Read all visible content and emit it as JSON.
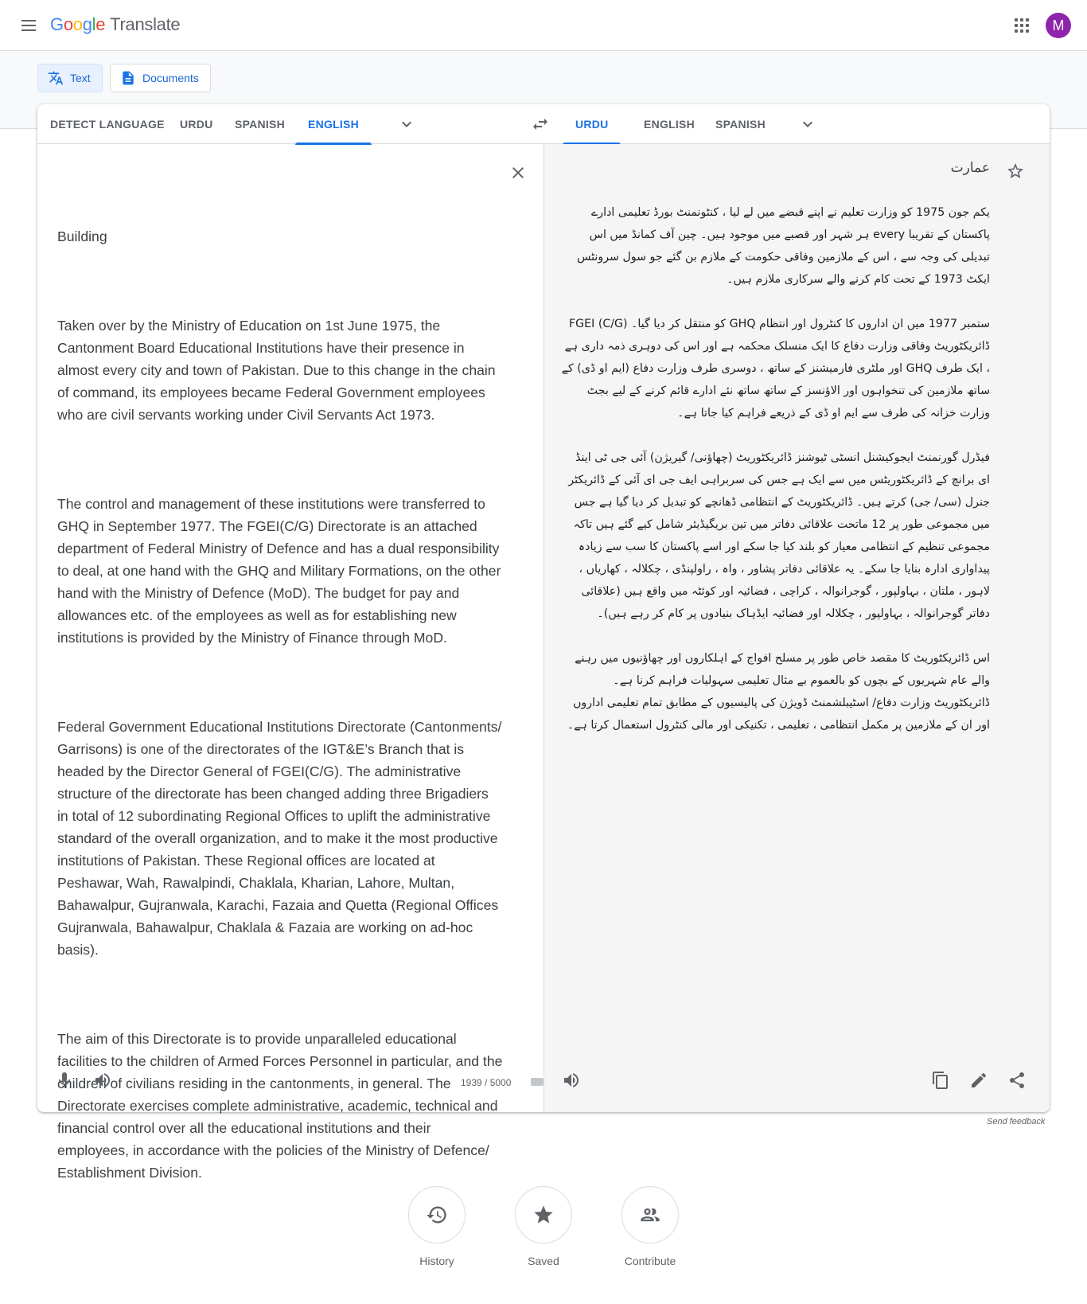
{
  "header": {
    "logo_letters": [
      "G",
      "o",
      "o",
      "g",
      "l",
      "e"
    ],
    "logo_colors": [
      "#4285f4",
      "#ea4335",
      "#fbbc05",
      "#4285f4",
      "#34a853",
      "#ea4335"
    ],
    "product": "Translate",
    "avatar_letter": "M",
    "avatar_color": "#8e24aa"
  },
  "modes": {
    "text": "Text",
    "documents": "Documents"
  },
  "source_langs": [
    "DETECT LANGUAGE",
    "URDU",
    "SPANISH",
    "ENGLISH"
  ],
  "source_active": "ENGLISH",
  "target_langs": [
    "URDU",
    "ENGLISH",
    "SPANISH"
  ],
  "target_active": "URDU",
  "source": {
    "paragraphs": [
      "Building",
      "Taken over by the Ministry of Education on 1st June 1975, the Cantonment Board Educational Institutions have their presence in almost every city and town of Pakistan. Due to this change in the chain of command, its employees became Federal Government employees who are civil servants working under Civil Servants Act 1973.",
      "The control and management of these institutions were transferred to GHQ in September 1977. The FGEI(C/G) Directorate is an attached department of Federal Ministry of Defence and has a dual responsibility to deal, at one hand with the GHQ and Military Formations, on the other hand with the Ministry of Defence (MoD). The budget for pay and allowances etc. of the employees as well as for establishing new institutions is provided by the Ministry of Finance through MoD.",
      "Federal Government Educational Institutions Directorate (Cantonments/ Garrisons) is one of the directorates of the IGT&E’s Branch that is headed by the Director General of FGEI(C/G). The administrative structure of the directorate has been changed adding three Brigadiers in total of 12 subordinating Regional Offices to uplift the administrative standard of the overall organization, and to make it the most productive institutions of Pakistan. These Regional offices are located at Peshawar, Wah, Rawalpindi, Chaklala, Kharian, Lahore, Multan, Bahawalpur, Gujranwala, Karachi, Fazaia and Quetta (Regional Offices Gujranwala, Bahawalpur, Chaklala & Fazaia are working on ad-hoc basis).",
      "The aim of this Directorate is to provide unparalleled educational facilities to the children of Armed Forces Personnel in particular, and the children of civilians residing in the cantonments, in general. The Directorate exercises complete administrative, academic, technical and financial control over all the educational institutions and their employees, in accordance with the policies of the Ministry of Defence/ Establishment Division."
    ],
    "char_count": "1939 / 5000"
  },
  "target": {
    "word": "عمارت",
    "paragraphs": [
      "یکم جون 1975 کو وزارت تعلیم نے اپنے قبضے میں لے لیا ، کنٹونمنٹ بورڈ تعلیمی ادارے پاکستان کے تقریبا every ہر شہر اور قصبے میں موجود ہیں۔ چین آف کمانڈ میں اس تبدیلی کی وجہ سے ، اس کے ملازمین وفاقی حکومت کے ملازم بن گئے جو سول سرونٹس ایکٹ 1973 کے تحت کام کرنے والے سرکاری ملازم ہیں۔",
      "ستمبر 1977 میں ان اداروں کا کنٹرول اور انتظام GHQ کو منتقل کر دیا گیا۔ FGEI (C/G) ڈائریکٹوریٹ وفاقی وزارت دفاع کا ایک منسلک محکمہ ہے اور اس کی دوہری ذمہ داری ہے ، ایک طرف GHQ اور ملٹری فارمیشنز کے ساتھ ، دوسری طرف وزارت دفاع (ایم او ڈی) کے ساتھ ملازمین کی تنخواہوں اور الاؤنسز کے ساتھ ساتھ نئے ادارے قائم کرنے کے لیے بجٹ وزارت خزانہ کی طرف سے ایم او ڈی کے ذریعے فراہم کیا جاتا ہے۔",
      "فیڈرل گورنمنٹ ایجوکیشنل انسٹی ٹیوشنز ڈائریکٹوریٹ (چھاؤنی/ گیریژن) آئی جی ٹی اینڈ ای برانچ کے ڈائریکٹوریٹس میں سے ایک ہے جس کی سربراہی ایف جی ای آئی کے ڈائریکٹر جنرل (سی/ جی) کرتے ہیں۔ ڈائریکٹوریٹ کے انتظامی ڈھانچے کو تبدیل کر دیا گیا ہے جس میں مجموعی طور پر 12 ماتحت علاقائی دفاتر میں تین بریگیڈیئر شامل کیے گئے ہیں تاکہ مجموعی تنظیم کے انتظامی معیار کو بلند کیا جا سکے اور اسے پاکستان کا سب سے زیادہ پیداواری ادارہ بنایا جا سکے۔ یہ علاقائی دفاتر پشاور ، واہ ، راولپنڈی ، چکلالہ ، کھاریاں ، لاہور ، ملتان ، بہاولپور ، گوجرانوالہ ، کراچی ، فضائیہ اور کوئٹہ میں واقع ہیں (علاقائی دفاتر گوجرانوالہ ، بہاولپور ، چکلالہ اور فضائیہ ایڈہاک بنیادوں پر کام کر رہے ہیں)۔",
      "اس ڈائریکٹوریٹ کا مقصد خاص طور پر مسلح افواج کے اہلکاروں اور چھاؤنیوں میں رہنے والے عام شہریوں کے بچوں کو بالعموم بے مثال تعلیمی سہولیات فراہم کرنا ہے۔ ڈائریکٹوریٹ وزارت دفاع/ اسٹیبلشمنٹ ڈویژن کی پالیسیوں کے مطابق تمام تعلیمی اداروں اور ان کے ملازمین پر مکمل انتظامی ، تعلیمی ، تکنیکی اور مالی کنٹرول استعمال کرتا ہے۔"
    ]
  },
  "footer": {
    "send_feedback": "Send feedback",
    "actions": [
      "History",
      "Saved",
      "Contribute"
    ]
  },
  "colors": {
    "accent": "#1a73e8",
    "text": "#3c4043",
    "muted": "#5f6368"
  }
}
